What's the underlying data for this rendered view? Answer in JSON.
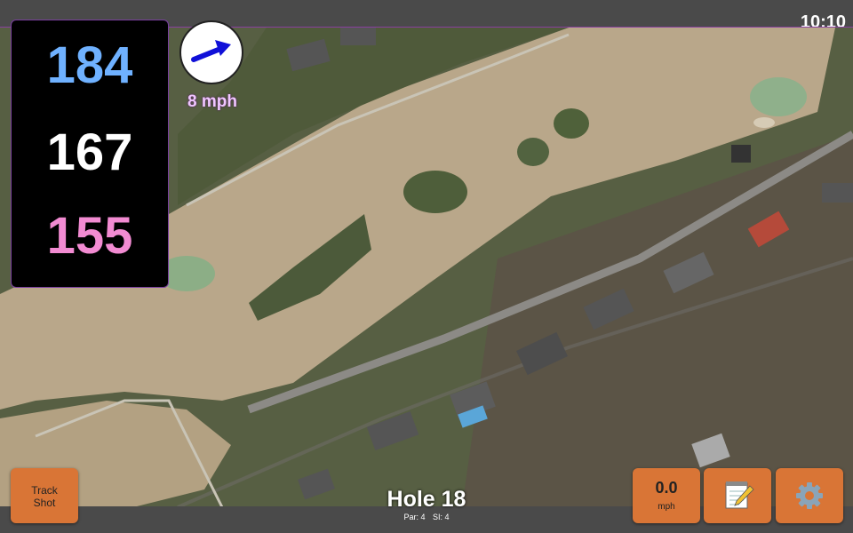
{
  "status": {
    "time": "10:10"
  },
  "distances": {
    "back": "184",
    "middle": "167",
    "front": "155"
  },
  "wind": {
    "speed_label": "8 mph",
    "direction_icon": "wind-arrow-icon"
  },
  "hole": {
    "title": "Hole 18",
    "par": "Par: 4",
    "stroke_index": "SI: 4"
  },
  "buttons": {
    "track_shot_line1": "Track",
    "track_shot_line2": "Shot",
    "speed_value": "0.0",
    "speed_unit": "mph",
    "notes_icon": "notepad-icon",
    "settings_icon": "gear-icon"
  },
  "colors": {
    "back_distance": "#6fb1ff",
    "middle_distance": "#ffffff",
    "front_distance": "#f28bd2",
    "button": "#d97536",
    "wind_arrow": "#1010d8"
  }
}
